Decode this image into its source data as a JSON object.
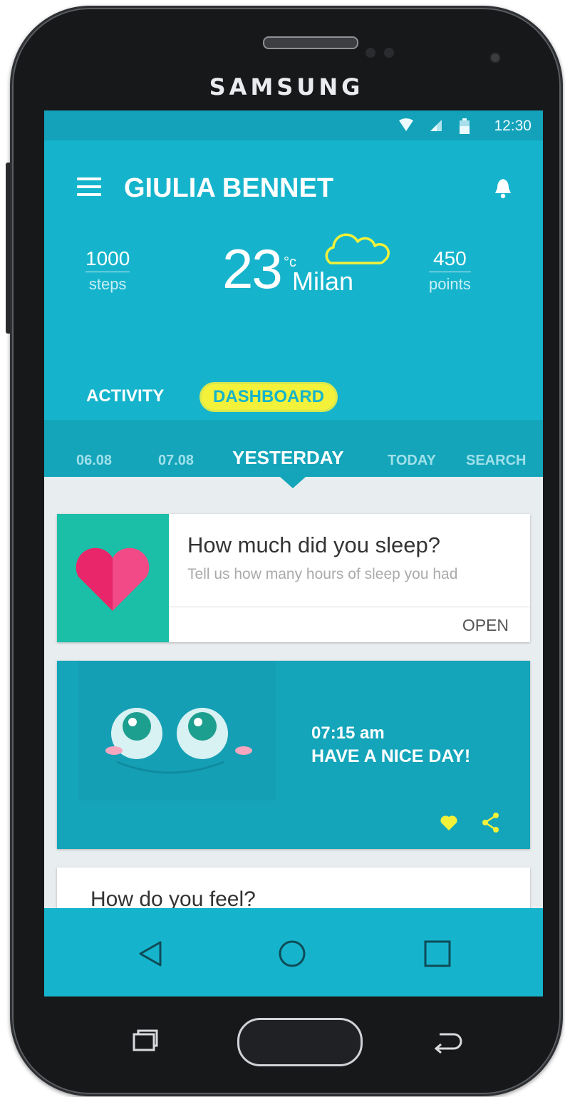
{
  "device": {
    "brand": "SAMSUNG"
  },
  "status_bar": {
    "time": "12:30",
    "icons": [
      "wifi-icon",
      "signal-icon",
      "battery-icon"
    ]
  },
  "header": {
    "title": "GIULIA BENNET",
    "menu_icon": "hamburger-menu-icon",
    "notification_icon": "bell-icon"
  },
  "stats": {
    "steps": {
      "value": "1000",
      "label": "steps"
    },
    "points": {
      "value": "450",
      "label": "points"
    }
  },
  "weather": {
    "temperature": "23",
    "unit": "°c",
    "city": "Milan",
    "icon": "cloud-icon"
  },
  "tabs": [
    {
      "label": "ACTIVITY",
      "selected": false
    },
    {
      "label": "DASHBOARD",
      "selected": true
    }
  ],
  "date_tabs": [
    {
      "label": "06.08",
      "selected": false
    },
    {
      "label": "07.08",
      "selected": false
    },
    {
      "label": "YESTERDAY",
      "selected": true
    },
    {
      "label": "TODAY",
      "selected": false
    },
    {
      "label": "SEARCH",
      "selected": false
    }
  ],
  "sleep_card": {
    "title": "How much did you sleep?",
    "subtitle": "Tell us how many hours of sleep you had",
    "action": "OPEN",
    "icon": "heart-icon"
  },
  "greeting_card": {
    "time": "07:15 am",
    "message": "HAVE A NICE DAY!",
    "icons": [
      "smiley-face-icon",
      "heart-icon",
      "share-icon"
    ]
  },
  "feel_card": {
    "title": "How do you feel?"
  },
  "nav_bar": {
    "icons": [
      "back-icon",
      "home-icon",
      "recents-icon"
    ]
  },
  "hardware_keys": {
    "icons": [
      "recent-apps-icon",
      "home-button",
      "back-icon"
    ]
  },
  "colors": {
    "primary": "#16b4cc",
    "primary_dark": "#14a5ba",
    "accent": "#f3f13a",
    "heart_tile": "#1bbfa7",
    "heart": "#e9266a"
  }
}
